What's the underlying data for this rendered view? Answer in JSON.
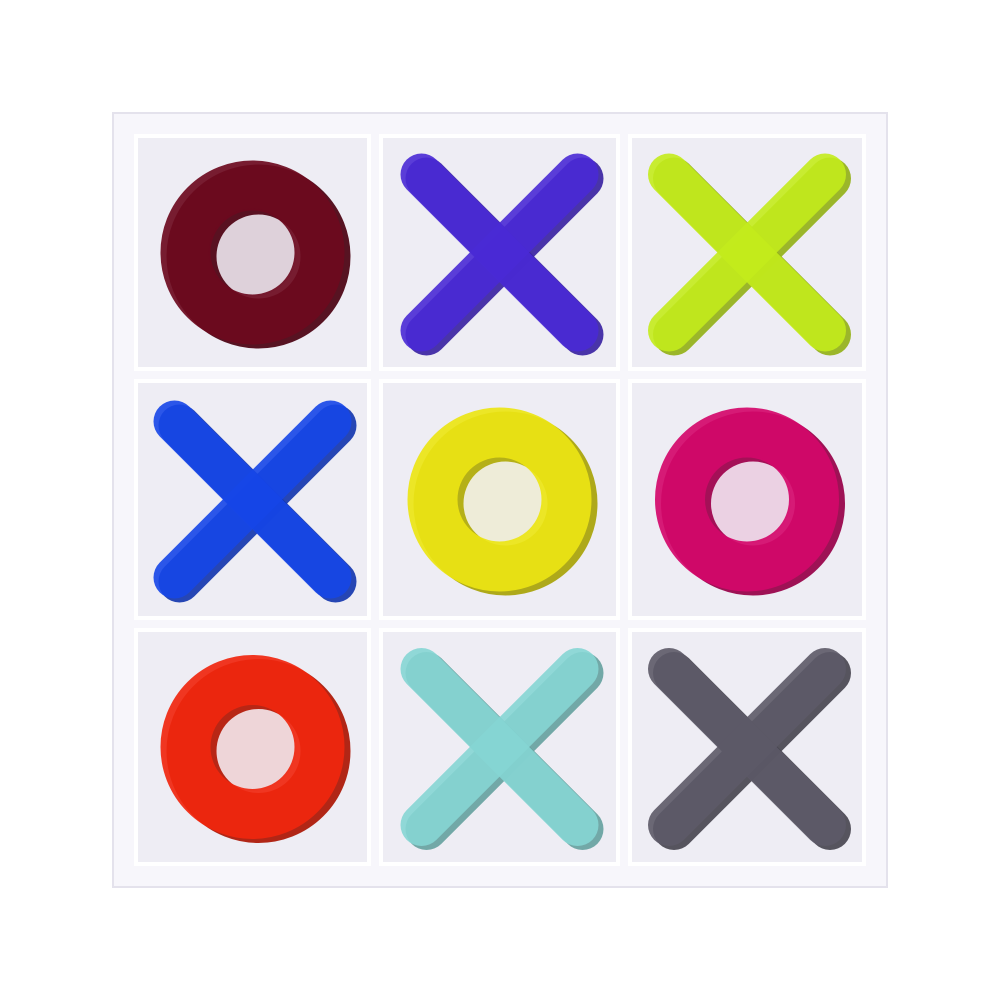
{
  "board": {
    "rows": 3,
    "cols": 3,
    "background": "#ffffff",
    "tray_color": "#f7f6fb",
    "cell_color": "#eeedf4",
    "divider_color": "#ffffff",
    "edge_color": "#e4e2ec"
  },
  "pieces": [
    {
      "row": 0,
      "col": 0,
      "type": "O",
      "color": "#6d0a1e",
      "name": "o-piece-maroon"
    },
    {
      "row": 0,
      "col": 1,
      "type": "X",
      "color": "#4a2ad6",
      "name": "x-piece-purple"
    },
    {
      "row": 0,
      "col": 2,
      "type": "X",
      "color": "#c4ec1c",
      "name": "x-piece-lime"
    },
    {
      "row": 1,
      "col": 0,
      "type": "X",
      "color": "#1646e8",
      "name": "x-piece-blue"
    },
    {
      "row": 1,
      "col": 1,
      "type": "O",
      "color": "#ece514",
      "name": "o-piece-yellow"
    },
    {
      "row": 1,
      "col": 2,
      "type": "O",
      "color": "#d4086a",
      "name": "o-piece-magenta"
    },
    {
      "row": 2,
      "col": 0,
      "type": "O",
      "color": "#f0260e",
      "name": "o-piece-red"
    },
    {
      "row": 2,
      "col": 1,
      "type": "X",
      "color": "#86d6d4",
      "name": "x-piece-aqua"
    },
    {
      "row": 2,
      "col": 2,
      "type": "X",
      "color": "#5d5a68",
      "name": "x-piece-gray"
    }
  ]
}
